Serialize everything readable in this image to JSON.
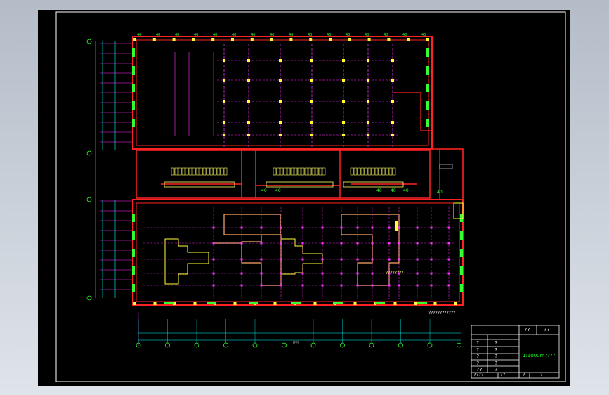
{
  "drawing": {
    "background": "#000000",
    "sheet_border": "#ffffff",
    "colors": {
      "wall": "#ff2222",
      "column": "#ffff33",
      "axis": "#ff33ff",
      "dimension": "#ff33ff",
      "grid_axis": "#33ff33",
      "cyan": "#00ffff",
      "fixture": "#ffff66",
      "partition": "#ffffff"
    },
    "dim_label_40": "40",
    "bottom_dimension": "????",
    "notes": {
      "area_note": "????????????",
      "room_note": "????????"
    }
  },
  "title_block": {
    "header_left": "??",
    "header_right": "??",
    "scale_text": "1:1000m????",
    "rows": [
      {
        "left": "?",
        "mid": "?"
      },
      {
        "left": "?",
        "mid": "?"
      },
      {
        "left": "?",
        "mid": "?"
      },
      {
        "left": "?",
        "mid": "?"
      },
      {
        "left": "??",
        "mid": "?"
      }
    ],
    "bottom": [
      "????",
      "??",
      "?",
      "?"
    ]
  }
}
